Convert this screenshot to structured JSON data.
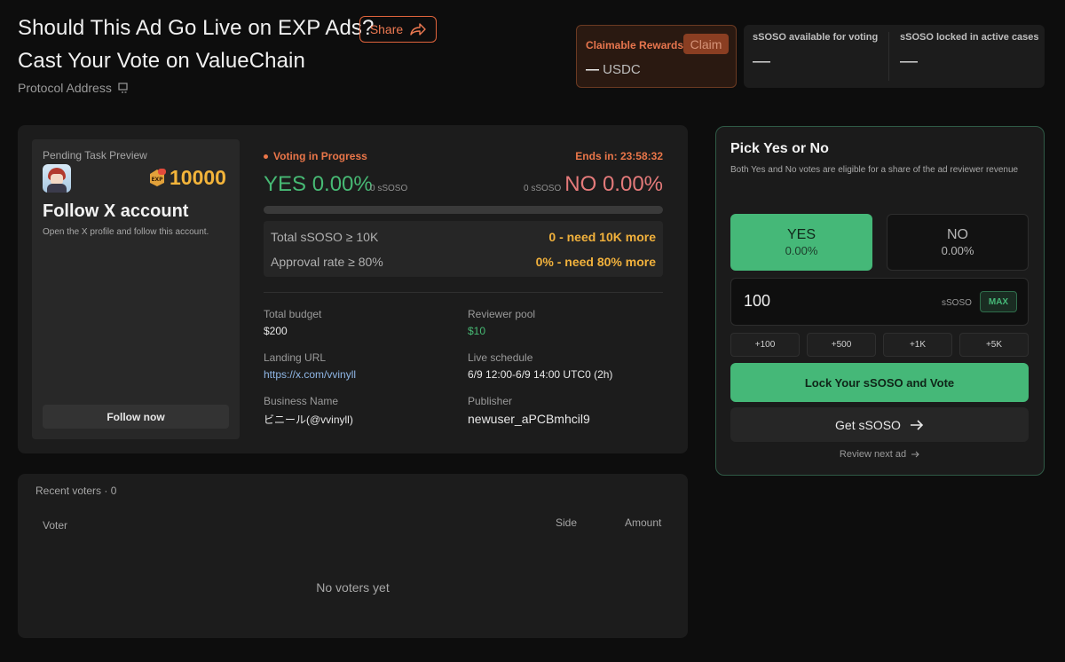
{
  "header": {
    "title_line1": "Should This Ad Go Live on EXP Ads?",
    "title_line2": "Cast Your Vote on ValueChain",
    "share_label": "Share",
    "protocol_label": "Protocol Address"
  },
  "rewards": {
    "label": "Claimable Rewards",
    "claim_label": "Claim",
    "dash": "—",
    "unit": "USDC"
  },
  "stats": {
    "available_label": "sSOSO available for voting",
    "available_value": "—",
    "locked_label": "sSOSO locked in active cases",
    "locked_value": "—"
  },
  "preview": {
    "title": "Pending Task Preview",
    "badge_text": "EXP",
    "points": "10000",
    "heading": "Follow X account",
    "description": "Open the X profile and follow this account.",
    "follow_label": "Follow now"
  },
  "voting": {
    "status": "Voting in Progress",
    "ends": "Ends in: 23:58:32",
    "yes_label": "YES 0.00%",
    "yes_amount": "0 sSOSO",
    "no_amount": "0 sSOSO",
    "no_label": "NO 0.00%",
    "yes_fraction": 0,
    "requirements": [
      {
        "label": "Total sSOSO ≥ 10K",
        "status": "0 - need 10K more"
      },
      {
        "label": "Approval rate ≥ 80%",
        "status": "0% - need 80% more"
      }
    ]
  },
  "details": {
    "total_budget_label": "Total budget",
    "total_budget": "$200",
    "reviewer_pool_label": "Reviewer pool",
    "reviewer_pool": "$10",
    "landing_url_label": "Landing URL",
    "landing_url": "https://x.com/vvinyll",
    "live_schedule_label": "Live schedule",
    "live_schedule": "6/9 12:00-6/9 14:00 UTC0 (2h)",
    "business_name_label": "Business Name",
    "business_name": "ビニール(@vvinyll)",
    "publisher_label": "Publisher",
    "publisher": "newuser_aPCBmhcil9"
  },
  "voters": {
    "title": "Recent voters · 0",
    "col_voter": "Voter",
    "col_side": "Side",
    "col_amount": "Amount",
    "empty": "No voters yet"
  },
  "vote_panel": {
    "title": "Pick Yes or No",
    "description": "Both Yes and No votes are eligible for a share of the ad reviewer revenue",
    "yes_label": "YES",
    "yes_pct": "0.00%",
    "no_label": "NO",
    "no_pct": "0.00%",
    "amount_value": "100",
    "amount_unit": "sSOSO",
    "max_label": "MAX",
    "chips": [
      "+100",
      "+500",
      "+1K",
      "+5K"
    ],
    "lock_label": "Lock Your sSOSO and Vote",
    "get_label": "Get sSOSO",
    "next_label": "Review next ad"
  },
  "colors": {
    "accent_green": "#45b878",
    "accent_orange": "#ea7649",
    "warning_yellow": "#f1b13c",
    "no_red": "#e47a7a"
  }
}
